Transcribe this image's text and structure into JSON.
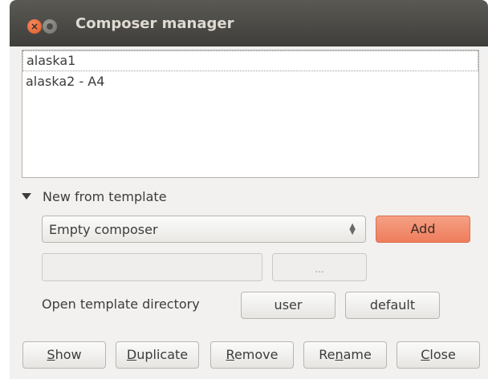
{
  "window": {
    "title": "Composer manager",
    "close_glyph": "×"
  },
  "composer_list": [
    {
      "label": "alaska1"
    },
    {
      "label": "alaska2 - A4"
    }
  ],
  "template_section": {
    "header": "New from template",
    "combo_value": "Empty composer",
    "add_label": "Add",
    "browse_label": "...",
    "template_path": "",
    "open_dir_label": "Open template directory",
    "user_label": "user",
    "default_label": "default"
  },
  "footer": {
    "show": {
      "mnemonic": "S",
      "rest": "how"
    },
    "duplicate": {
      "mnemonic": "D",
      "rest": "uplicate"
    },
    "remove": {
      "pre": "",
      "mnemonic": "R",
      "rest": "emove"
    },
    "rename": {
      "pre": "Re",
      "mnemonic": "n",
      "rest": "ame"
    },
    "close": {
      "mnemonic": "C",
      "rest": "lose"
    }
  },
  "colors": {
    "accent": "#ee7d5c",
    "titlebar": "#3f3e3a",
    "window_bg": "#f2f1f0"
  }
}
